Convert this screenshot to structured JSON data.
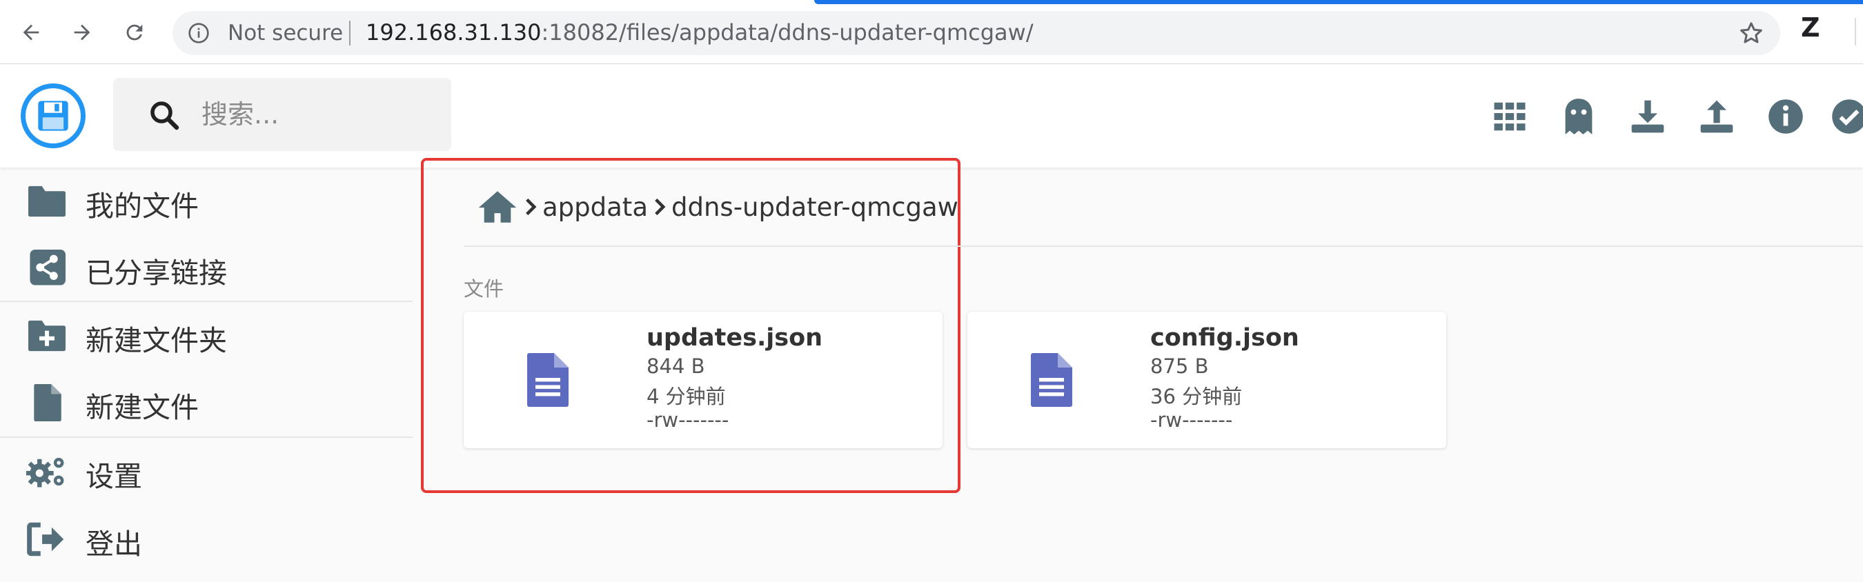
{
  "browser": {
    "security_label": "Not secure",
    "url_host": "192.168.31.130",
    "url_rest": ":18082/files/appdata/ddns-updater-qmcgaw/",
    "profile_initial": "Z"
  },
  "app": {
    "search_placeholder": "搜索...",
    "header_actions": [
      "grid-icon",
      "ghost-icon",
      "download-icon",
      "upload-icon",
      "info-icon",
      "check-icon"
    ]
  },
  "sidebar": {
    "items": [
      {
        "label": "我的文件",
        "icon": "folder-icon"
      },
      {
        "label": "已分享链接",
        "icon": "share-icon"
      },
      {
        "label": "新建文件夹",
        "icon": "new-folder-icon"
      },
      {
        "label": "新建文件",
        "icon": "new-file-icon"
      },
      {
        "label": "设置",
        "icon": "settings-icon"
      },
      {
        "label": "登出",
        "icon": "logout-icon"
      }
    ]
  },
  "breadcrumb": {
    "items": [
      "appdata",
      "ddns-updater-qmcgaw"
    ]
  },
  "main": {
    "section_label": "文件",
    "files": [
      {
        "name": "updates.json",
        "size": "844 B",
        "modified": "4 分钟前",
        "perms": "-rw-------"
      },
      {
        "name": "config.json",
        "size": "875 B",
        "modified": "36 分钟前",
        "perms": "-rw-------"
      }
    ]
  },
  "colors": {
    "accent_blue": "#2196f3",
    "file_icon": "#5c6bc0",
    "text_dark": "#333333",
    "header_icon": "#546e7a",
    "highlight_red": "#e53935"
  }
}
